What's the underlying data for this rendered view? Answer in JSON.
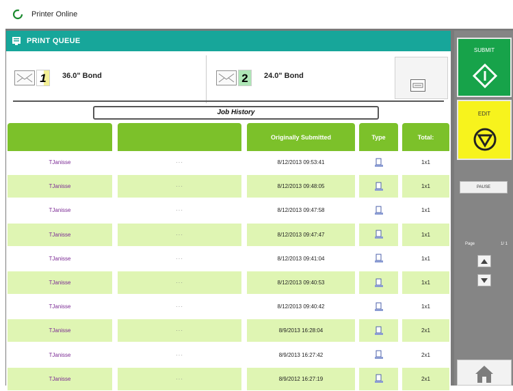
{
  "status": {
    "text": "Printer Online",
    "icon": "status-ring-icon",
    "color": "#1a8a2e"
  },
  "queue": {
    "title": "PRINT QUEUE",
    "header_color": "#17a69a"
  },
  "media": [
    {
      "number": "1",
      "label": "36.0\" Bond"
    },
    {
      "number": "2",
      "label": "24.0\" Bond"
    }
  ],
  "tab": {
    "label": "Job History"
  },
  "table": {
    "header_color": "#7cc12a",
    "columns": [
      "",
      "",
      "Originally Submitted",
      "Type",
      "Total:"
    ],
    "rows": [
      {
        "user": "TJanisse",
        "dots": "···",
        "date": "8/12/2013 09:53:41",
        "total": "1x1"
      },
      {
        "user": "TJanisse",
        "dots": "···",
        "date": "8/12/2013 09:48:05",
        "total": "1x1"
      },
      {
        "user": "TJanisse",
        "dots": "···",
        "date": "8/12/2013 09:47:58",
        "total": "1x1"
      },
      {
        "user": "TJanisse",
        "dots": "···",
        "date": "8/12/2013 09:47:47",
        "total": "1x1"
      },
      {
        "user": "TJanisse",
        "dots": "···",
        "date": "8/12/2013 09:41:04",
        "total": "1x1"
      },
      {
        "user": "TJanisse",
        "dots": "···",
        "date": "8/12/2013 09:40:53",
        "total": "1x1"
      },
      {
        "user": "TJanisse",
        "dots": "···",
        "date": "8/12/2013 09:40:42",
        "total": "1x1"
      },
      {
        "user": "TJanisse",
        "dots": "···",
        "date": "8/9/2013 16:28:04",
        "total": "2x1"
      },
      {
        "user": "TJanisse",
        "dots": "···",
        "date": "8/9/2013 16:27:42",
        "total": "2x1"
      },
      {
        "user": "TJanisse",
        "dots": "···",
        "date": "8/9/2012 16:27:19",
        "total": "2x1"
      }
    ]
  },
  "sidebar": {
    "submit_label": "SUBMIT",
    "submit_color": "#17a34a",
    "edit_label": "EDIT",
    "edit_color": "#f7f31d",
    "pause_label": "PAUSE",
    "page_label": "Page",
    "page_value": "1/ 1"
  }
}
